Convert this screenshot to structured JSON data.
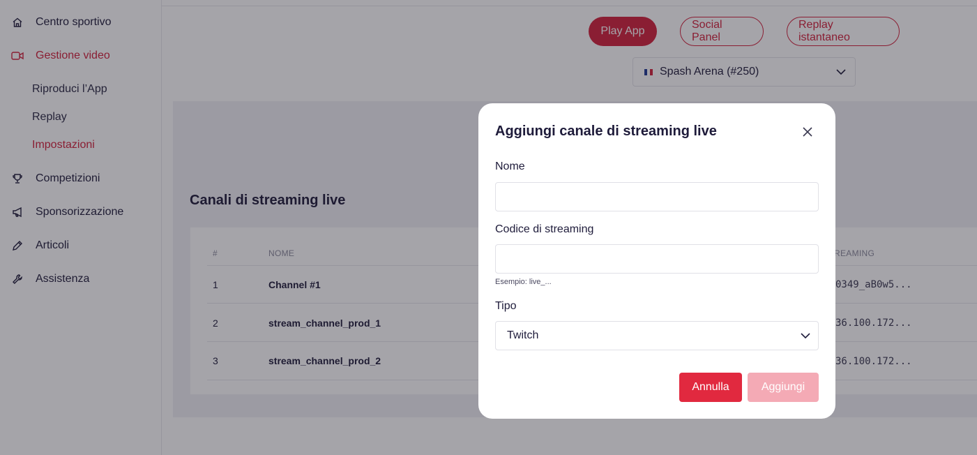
{
  "sidebar": {
    "items": [
      {
        "label": "Centro sportivo",
        "icon": "home-icon"
      },
      {
        "label": "Gestione video",
        "icon": "video-camera-icon"
      },
      {
        "label": "Competizioni",
        "icon": "trophy-icon"
      },
      {
        "label": "Sponsorizzazione",
        "icon": "megaphone-icon"
      },
      {
        "label": "Articoli",
        "icon": "pencil-icon"
      },
      {
        "label": "Assistenza",
        "icon": "wrench-icon"
      }
    ],
    "subitems": [
      "Riproduci l’App",
      "Replay",
      "Impostazioni"
    ],
    "active_item": "Gestione video",
    "active_subitem": "Impostazioni"
  },
  "header": {
    "buttons": [
      "Play App",
      "Social Panel",
      "Replay istantaneo"
    ],
    "venue": "Spash Arena  (#250)"
  },
  "section": {
    "title": "Canali di streaming live",
    "columns": [
      "#",
      "NOME",
      "REAMING"
    ],
    "rows": [
      {
        "num": "1",
        "name": "Channel #1",
        "code": "0349_aB0w5..."
      },
      {
        "num": "2",
        "name": "stream_channel_prod_1",
        "code": "36.100.172..."
      },
      {
        "num": "3",
        "name": "stream_channel_prod_2",
        "code": "36.100.172..."
      }
    ]
  },
  "modal": {
    "title": "Aggiungi canale di streaming live",
    "name_label": "Nome",
    "name_value": "",
    "code_label": "Codice di streaming",
    "code_value": "",
    "code_hint": "Esempio: live_...",
    "type_label": "Tipo",
    "type_value": "Twitch",
    "cancel_label": "Annulla",
    "add_label": "Aggiungi"
  },
  "colors": {
    "accent": "#d2213b",
    "add_disabled": "#f4aab5"
  }
}
